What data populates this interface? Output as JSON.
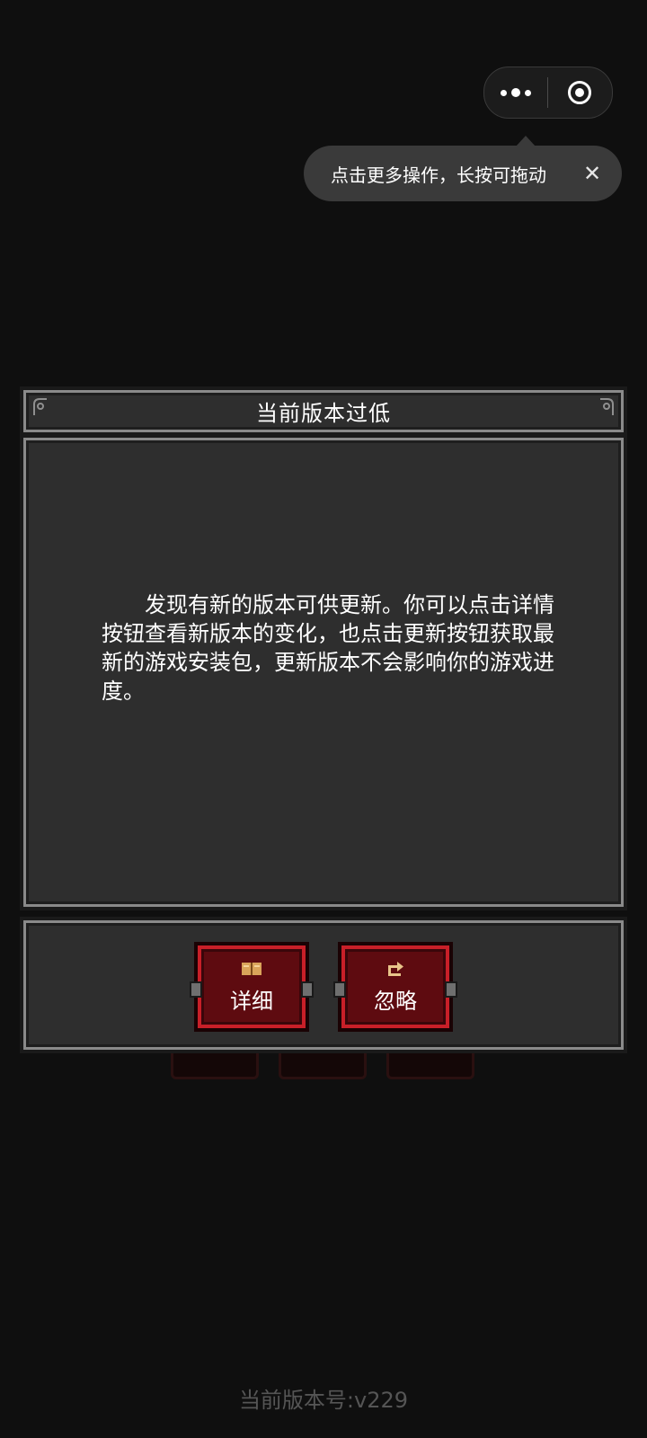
{
  "capsule": {
    "more_icon": "more-dots-icon",
    "close_icon": "target-circle-icon"
  },
  "tooltip": {
    "text": "点击更多操作，长按可拖动",
    "close_symbol": "✕"
  },
  "dialog": {
    "title": "当前版本过低",
    "message": "发现有新的版本可供更新。你可以点击详情按钮查看新版本的变化，也点击更新按钮获取最新的游戏安装包，更新版本不会影响你的游戏进度。",
    "buttons": {
      "detail": {
        "label": "详细",
        "icon": "book-icon"
      },
      "ignore": {
        "label": "忽略",
        "icon": "skip-arrow-icon"
      }
    }
  },
  "footer": {
    "version": "当前版本号:v229"
  }
}
